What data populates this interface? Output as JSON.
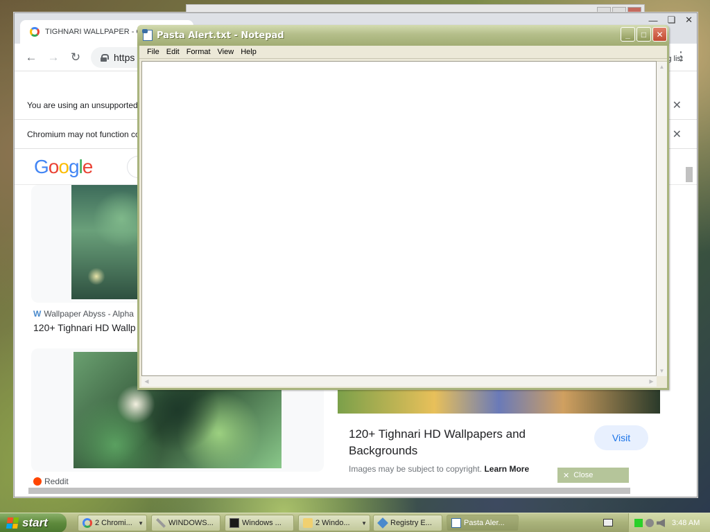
{
  "chromium": {
    "tab_title": "TIGHNARI WALLPAPER - G",
    "address_partial": "https",
    "reading_list_partial": "g list",
    "infobar_unsupported": "You are using an unsupported",
    "infobar_chromium": "Chromium may not function co",
    "search_results": {
      "result1_source": "Wallpaper Abyss - Alpha",
      "result1_title": "120+ Tighnari HD Wallp",
      "result2_source": "Reddit"
    },
    "preview_panel": {
      "title": "120+ Tighnari HD Wallpapers and Backgrounds",
      "visit_label": "Visit",
      "copyright_text": "Images may be subject to copyright.",
      "learn_more": "Learn More",
      "close_hint": "Close"
    }
  },
  "notepad": {
    "title": "Pasta Alert.txt - Notepad",
    "menu": [
      "File",
      "Edit",
      "Format",
      "View",
      "Help"
    ],
    "content": ""
  },
  "taskbar": {
    "start_label": "start",
    "items": [
      {
        "label": "2 Chromi...",
        "icon": "chrome-icon",
        "grouped": true
      },
      {
        "label": "WINDOWS...",
        "icon": "wrench-icon",
        "grouped": false
      },
      {
        "label": "Windows ...",
        "icon": "command-prompt-icon",
        "grouped": false
      },
      {
        "label": "2 Windo...",
        "icon": "folder-icon",
        "grouped": true
      },
      {
        "label": "Registry E...",
        "icon": "registry-editor-icon",
        "grouped": false
      },
      {
        "label": "Pasta Aler...",
        "icon": "notepad-icon",
        "grouped": false,
        "active": true
      }
    ],
    "clock": "3:48 AM"
  },
  "colors": {
    "xp_olive_title": "#a2ad74",
    "taskbar": "#a9b27a",
    "start_green": "#5e8a3c",
    "chrome_blue": "#1a73e8"
  }
}
